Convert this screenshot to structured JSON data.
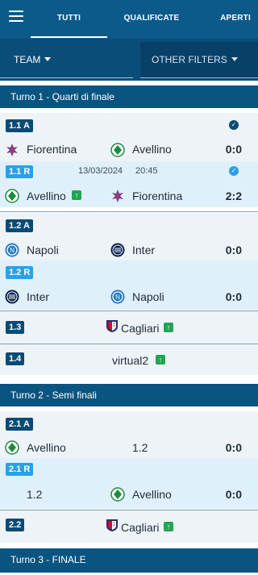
{
  "tabs": [
    "TUTTI",
    "QUALIFICATE",
    "APERTI"
  ],
  "filters": {
    "team": "TEAM",
    "other": "OTHER FILTERS"
  },
  "colors": {
    "header": "#0c5a8a",
    "dark_badge": "#0a4b74",
    "light_badge": "#2aa1e6",
    "win_icon": "#21a553"
  },
  "rounds": [
    {
      "title": "Turno 1 - Quarti di finale",
      "matches": [
        {
          "badge": "1.1 A",
          "home": "Fiorentina",
          "away": "Avellino",
          "score": "0:0"
        },
        {
          "badge": "1.1 R",
          "date": "13/03/2024",
          "time": "20:45",
          "home": "Avellino",
          "away": "Fiorentina",
          "score": "2:2"
        },
        {
          "badge": "1.2 A",
          "home": "Napoli",
          "away": "Inter",
          "score": "0:0"
        },
        {
          "badge": "1.2 R",
          "home": "Inter",
          "away": "Napoli",
          "score": "0:0"
        },
        {
          "badge": "1.3",
          "team": "Cagliari"
        },
        {
          "badge": "1.4",
          "team": "virtual2"
        }
      ]
    },
    {
      "title": "Turno 2 - Semi finali",
      "matches": [
        {
          "badge": "2.1 A",
          "home": "Avellino",
          "away": "1.2",
          "score": "0:0"
        },
        {
          "badge": "2.1 R",
          "home": "1.2",
          "away": "Avellino",
          "score": "0:0"
        },
        {
          "badge": "2.2",
          "team": "Cagliari"
        }
      ]
    },
    {
      "title": "Turno 3 - FINALE"
    }
  ]
}
